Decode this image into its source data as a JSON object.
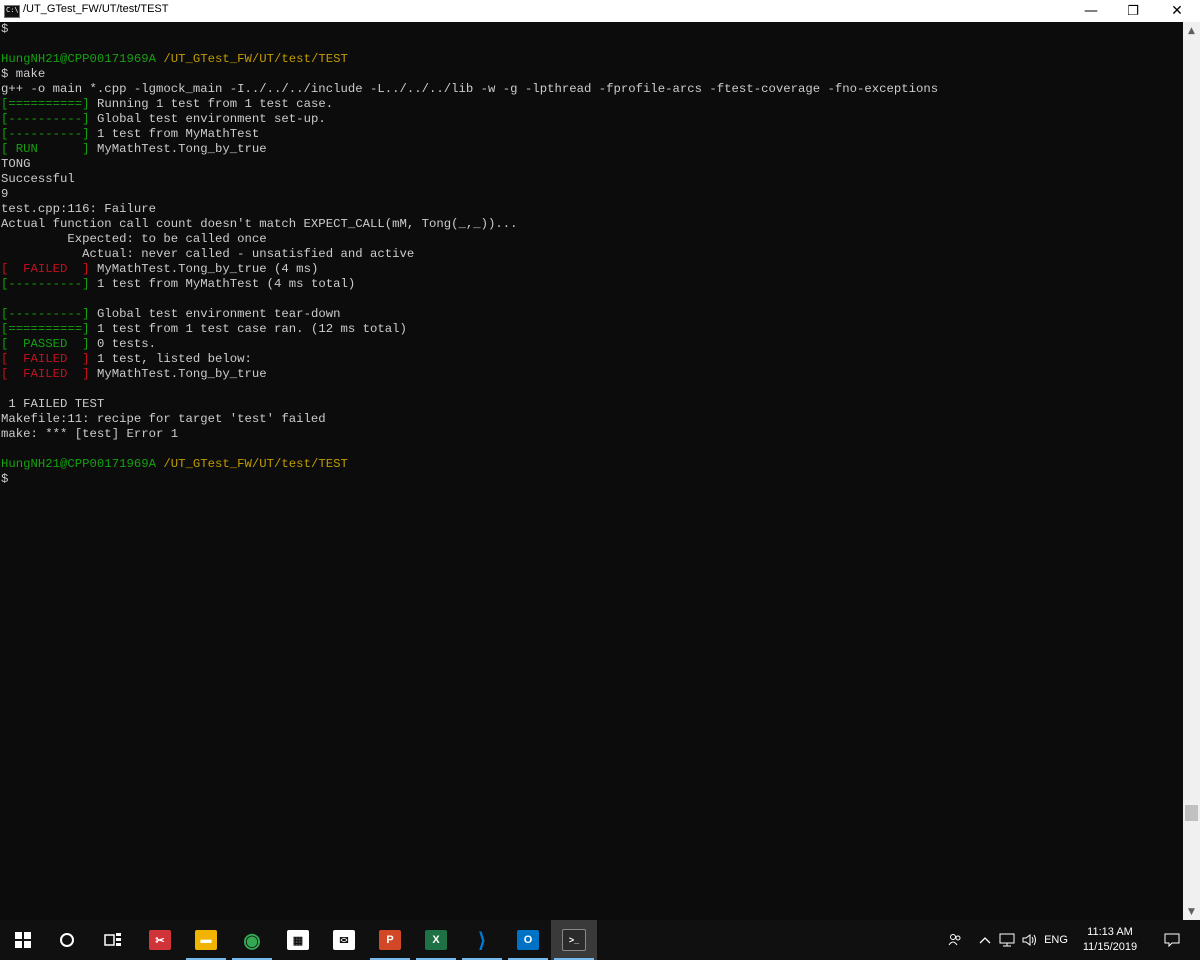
{
  "window": {
    "title": "/UT_GTest_FW/UT/test/TEST",
    "app_icon_label": "C:\\",
    "controls": {
      "minimize": "—",
      "restore": "❐",
      "close": "✕"
    }
  },
  "terminal": {
    "colors": {
      "green": "#13a10e",
      "yellow": "#c19c00",
      "red": "#c50f1f",
      "default": "#cccccc",
      "background": "#0c0c0c"
    },
    "lines": [
      [
        {
          "t": "$"
        }
      ],
      [
        {
          "t": ""
        }
      ],
      [
        {
          "t": "HungNH21@CPP00171969A",
          "c": "g"
        },
        {
          "t": " "
        },
        {
          "t": "/UT_GTest_FW/UT/test/TEST",
          "c": "y"
        }
      ],
      [
        {
          "t": "$ make"
        }
      ],
      [
        {
          "t": "g++ -o main *.cpp -lgmock_main -I../../../include -L../../../lib -w -g -lpthread -fprofile-arcs -ftest-coverage -fno-exceptions"
        }
      ],
      [
        {
          "t": "[==========]",
          "c": "g"
        },
        {
          "t": " Running 1 test from 1 test case."
        }
      ],
      [
        {
          "t": "[----------]",
          "c": "g"
        },
        {
          "t": " Global test environment set-up."
        }
      ],
      [
        {
          "t": "[----------]",
          "c": "g"
        },
        {
          "t": " 1 test from MyMathTest"
        }
      ],
      [
        {
          "t": "[ RUN      ]",
          "c": "g"
        },
        {
          "t": " MyMathTest.Tong_by_true"
        }
      ],
      [
        {
          "t": "TONG"
        }
      ],
      [
        {
          "t": "Successful"
        }
      ],
      [
        {
          "t": "9"
        }
      ],
      [
        {
          "t": "test.cpp:116: Failure"
        }
      ],
      [
        {
          "t": "Actual function call count doesn't match EXPECT_CALL(mM, Tong(_,_))..."
        }
      ],
      [
        {
          "t": "         Expected: to be called once"
        }
      ],
      [
        {
          "t": "           Actual: never called - unsatisfied and active"
        }
      ],
      [
        {
          "t": "[  FAILED  ]",
          "c": "r"
        },
        {
          "t": " MyMathTest.Tong_by_true (4 ms)"
        }
      ],
      [
        {
          "t": "[----------]",
          "c": "g"
        },
        {
          "t": " 1 test from MyMathTest (4 ms total)"
        }
      ],
      [
        {
          "t": ""
        }
      ],
      [
        {
          "t": "[----------]",
          "c": "g"
        },
        {
          "t": " Global test environment tear-down"
        }
      ],
      [
        {
          "t": "[==========]",
          "c": "g"
        },
        {
          "t": " 1 test from 1 test case ran. (12 ms total)"
        }
      ],
      [
        {
          "t": "[  PASSED  ]",
          "c": "g"
        },
        {
          "t": " 0 tests."
        }
      ],
      [
        {
          "t": "[  FAILED  ]",
          "c": "r"
        },
        {
          "t": " 1 test, listed below:"
        }
      ],
      [
        {
          "t": "[  FAILED  ]",
          "c": "r"
        },
        {
          "t": " MyMathTest.Tong_by_true"
        }
      ],
      [
        {
          "t": ""
        }
      ],
      [
        {
          "t": " 1 FAILED TEST"
        }
      ],
      [
        {
          "t": "Makefile:11: recipe for target 'test' failed"
        }
      ],
      [
        {
          "t": "make: *** [test] Error 1"
        }
      ],
      [
        {
          "t": ""
        }
      ],
      [
        {
          "t": "HungNH21@CPP00171969A",
          "c": "g"
        },
        {
          "t": " "
        },
        {
          "t": "/UT_GTest_FW/UT/test/TEST",
          "c": "y"
        }
      ],
      [
        {
          "t": "$"
        }
      ]
    ]
  },
  "taskbar": {
    "start_icon": "windows-start-icon",
    "search_icon": "cortana-circle-icon",
    "task_view_icon": "task-view-icon",
    "apps": [
      {
        "name": "snipping-tool-icon",
        "glyph": "✂",
        "color": "#d13438"
      },
      {
        "name": "file-explorer-icon",
        "glyph": "▬",
        "color": "#f0b400"
      },
      {
        "name": "chrome-icon",
        "glyph": "◉",
        "color": "#34a853"
      },
      {
        "name": "store-icon",
        "glyph": "▦",
        "color": "#ffffff"
      },
      {
        "name": "mail-icon",
        "glyph": "✉",
        "color": "#ffffff"
      },
      {
        "name": "powerpoint-icon",
        "glyph": "P",
        "color": "#d24726"
      },
      {
        "name": "excel-icon",
        "glyph": "X",
        "color": "#1e7145"
      },
      {
        "name": "vscode-icon",
        "glyph": "⟩",
        "color": "#0078d4"
      },
      {
        "name": "outlook-icon",
        "glyph": "O",
        "color": "#0072c6"
      },
      {
        "name": "terminal-icon",
        "glyph": ">_",
        "color": "#2b2b2b",
        "active": true
      }
    ],
    "tray": {
      "people_icon": "people-icon",
      "chevron_icon": "chevron-up-icon",
      "network_icon": "network-icon",
      "volume_icon": "volume-icon",
      "language": "ENG",
      "time": "11:13 AM",
      "date": "11/15/2019",
      "notification_icon": "notification-icon"
    }
  }
}
